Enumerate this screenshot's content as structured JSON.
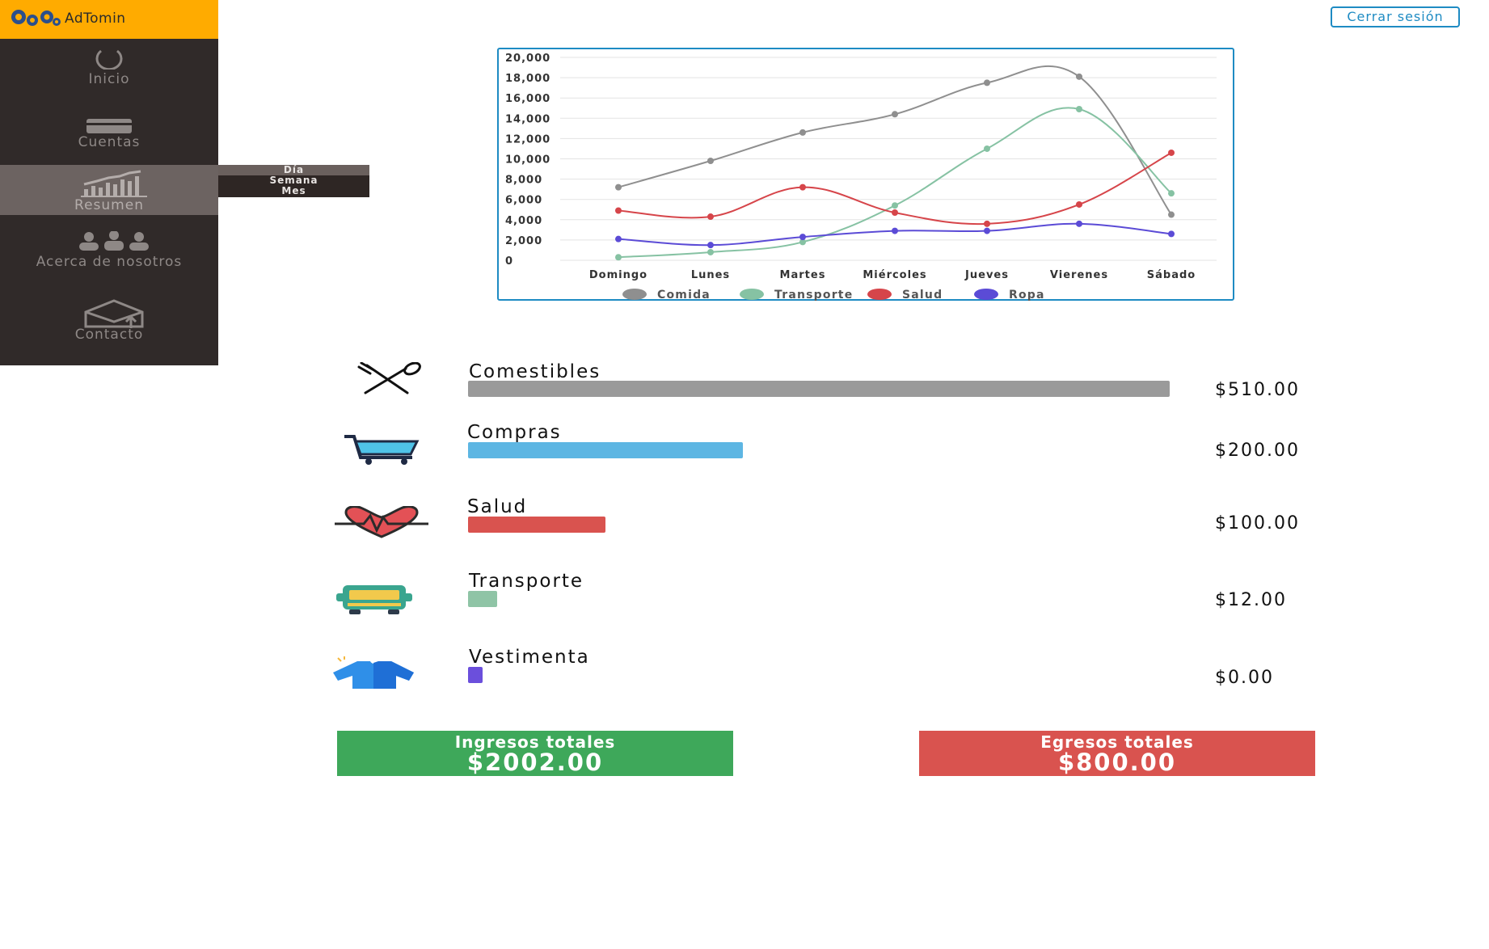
{
  "brand": {
    "name": "AdTomin",
    "color": "#ffab00"
  },
  "header": {
    "logout_label": "Cerrar sesión"
  },
  "sidebar": {
    "items": [
      {
        "label": "Inicio",
        "icon": "power-icon"
      },
      {
        "label": "Cuentas",
        "icon": "card-icon"
      },
      {
        "label": "Resumen",
        "icon": "chart-icon",
        "active": true
      },
      {
        "label": "Acerca de nosotros",
        "icon": "team-icon"
      },
      {
        "label": "Contacto",
        "icon": "mail-icon"
      }
    ],
    "submenu": [
      "Día",
      "Semana",
      "Mes"
    ]
  },
  "chart_data": {
    "type": "line",
    "categories": [
      "Domingo",
      "Lunes",
      "Martes",
      "Miércoles",
      "Jueves",
      "Vierenes",
      "Sábado"
    ],
    "ylim": [
      0,
      20000
    ],
    "yticks": [
      "20,000",
      "18,000",
      "16,000",
      "14,000",
      "12,000",
      "10,000",
      "8,000",
      "6,000",
      "4,000",
      "2,000",
      "0"
    ],
    "grid": true,
    "legend_position": "bottom",
    "series": [
      {
        "name": "Comida",
        "color": "#8f8f8f",
        "values": [
          7200,
          9800,
          12600,
          14400,
          17500,
          18100,
          4500
        ]
      },
      {
        "name": "Transporte",
        "color": "#86c2a3",
        "values": [
          300,
          800,
          1800,
          5400,
          11000,
          14900,
          6600
        ]
      },
      {
        "name": "Salud",
        "color": "#d6454a",
        "values": [
          4900,
          4300,
          7200,
          4700,
          3600,
          5500,
          10600
        ]
      },
      {
        "name": "Ropa",
        "color": "#5b4bd6",
        "values": [
          2100,
          1500,
          2300,
          2900,
          2900,
          3600,
          2600
        ]
      }
    ]
  },
  "categories": [
    {
      "name": "Comestibles",
      "amount": "$510.00",
      "value": 510,
      "color": "#9a9a9a",
      "icon": "fork-spoon-icon"
    },
    {
      "name": "Compras",
      "amount": "$200.00",
      "value": 200,
      "color": "#5db6e3",
      "icon": "cart-icon"
    },
    {
      "name": "Salud",
      "amount": "$100.00",
      "value": 100,
      "color": "#d9534f",
      "icon": "heart-icon"
    },
    {
      "name": "Transporte",
      "amount": "$12.00",
      "value": 12,
      "color": "#8fc4a6",
      "icon": "bus-icon"
    },
    {
      "name": "Vestimenta",
      "amount": "$0.00",
      "value": 0,
      "color": "#6b4fdc",
      "icon": "shirt-icon"
    }
  ],
  "totals": {
    "income": {
      "label": "Ingresos totales",
      "value": "$2002.00",
      "color": "#3ea85a"
    },
    "expenses": {
      "label": "Egresos totales",
      "value": "$800.00",
      "color": "#d9534f"
    }
  }
}
